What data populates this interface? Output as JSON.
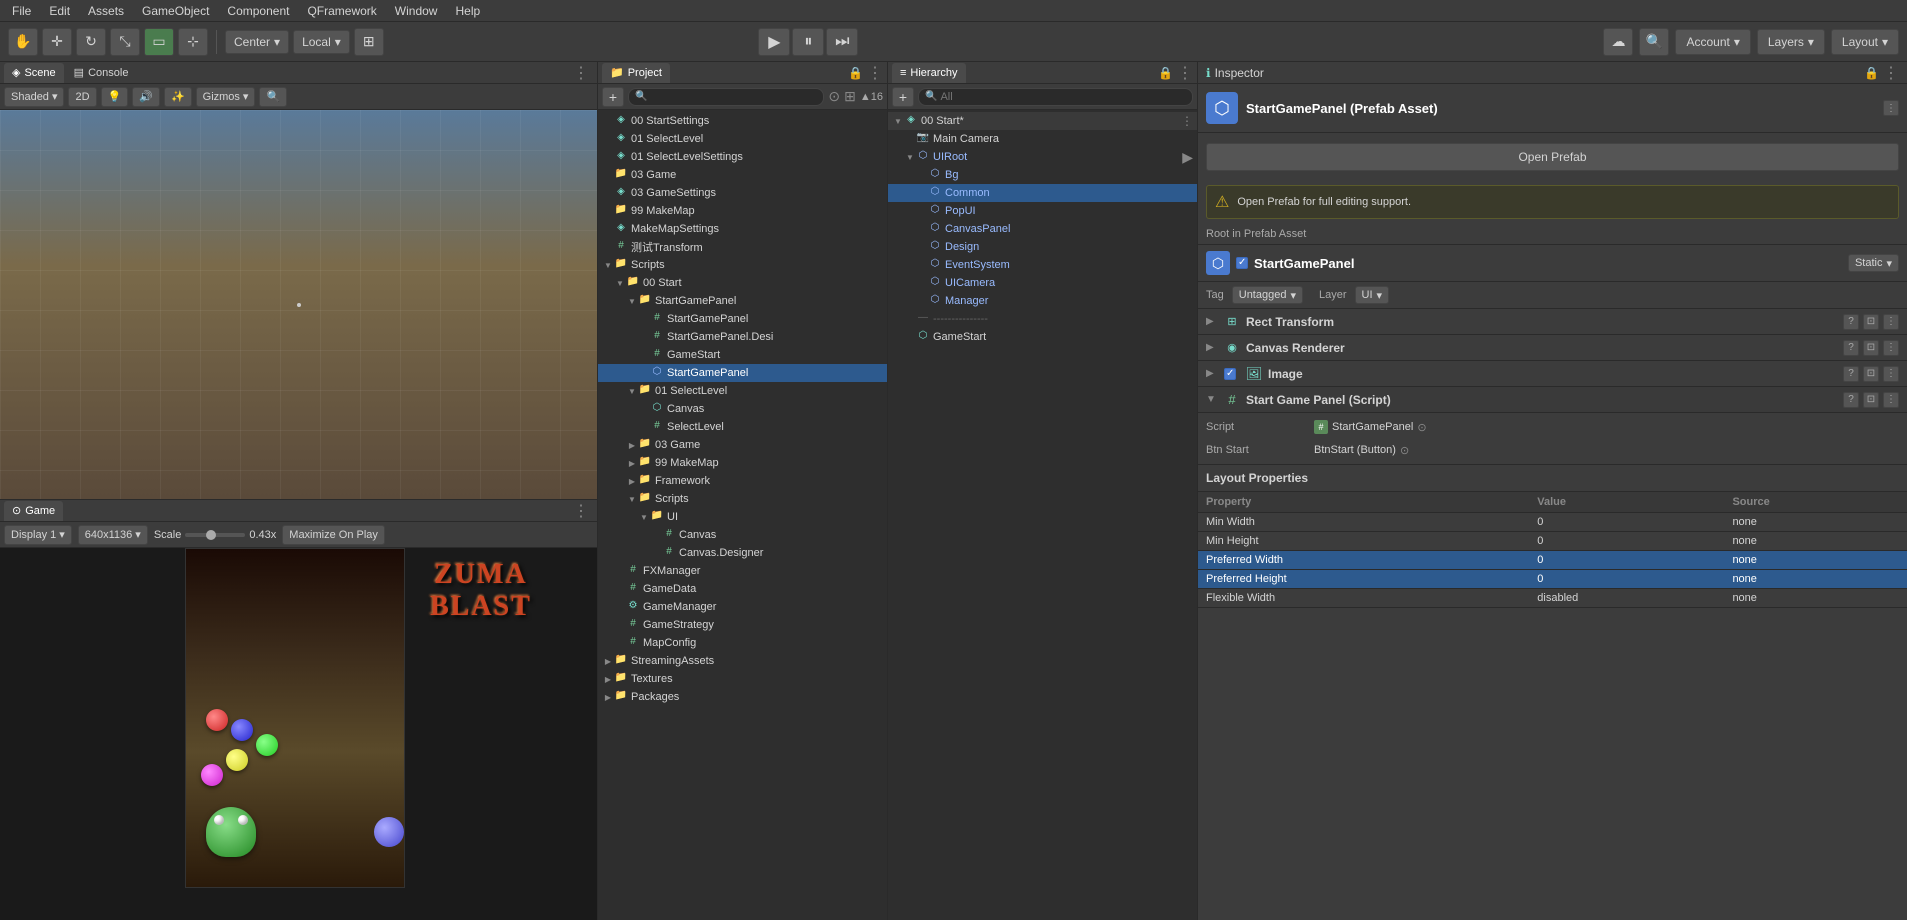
{
  "menubar": {
    "items": [
      "File",
      "Edit",
      "Assets",
      "GameObject",
      "Component",
      "QFramework",
      "Window",
      "Help"
    ]
  },
  "toolbar": {
    "tools": [
      "hand",
      "move",
      "rotate",
      "scale",
      "rect",
      "transform"
    ],
    "pivot_label": "Center",
    "space_label": "Local",
    "play_btn": "▶",
    "pause_btn": "⏸",
    "step_btn": "⏭",
    "account_label": "Account",
    "layers_label": "Layers",
    "layout_label": "Layout"
  },
  "scene_panel": {
    "tab_scene": "Scene",
    "tab_console": "Console",
    "shaded_label": "Shaded",
    "is_2d": "2D",
    "gizmos_label": "Gizmos"
  },
  "game_panel": {
    "tab_game": "Game",
    "display_label": "Display 1",
    "resolution_label": "640x1136",
    "scale_label": "Scale",
    "scale_value": "0.43x",
    "maximize_label": "Maximize On Play"
  },
  "project_panel": {
    "tab_label": "Project",
    "items": [
      {
        "name": "00 StartSettings",
        "type": "scene",
        "depth": 0
      },
      {
        "name": "01 SelectLevel",
        "type": "scene",
        "depth": 0
      },
      {
        "name": "01 SelectLevelSettings",
        "type": "scene",
        "depth": 0
      },
      {
        "name": "03 Game",
        "type": "folder",
        "depth": 0
      },
      {
        "name": "03 GameSettings",
        "type": "scene",
        "depth": 0
      },
      {
        "name": "99 MakeMap",
        "type": "folder",
        "depth": 0
      },
      {
        "name": "MakeMapSettings",
        "type": "scene",
        "depth": 0
      },
      {
        "name": "测试Transform",
        "type": "script",
        "depth": 0
      },
      {
        "name": "Scripts",
        "type": "folder",
        "depth": 0
      },
      {
        "name": "00 Start",
        "type": "folder",
        "depth": 1
      },
      {
        "name": "StartGamePanel",
        "type": "folder",
        "depth": 2
      },
      {
        "name": "StartGamePanel",
        "type": "script",
        "depth": 3
      },
      {
        "name": "StartGamePanel.Desi",
        "type": "script",
        "depth": 3
      },
      {
        "name": "GameStart",
        "type": "script",
        "depth": 3
      },
      {
        "name": "StartGamePanel",
        "type": "prefab",
        "depth": 3,
        "selected": true
      },
      {
        "name": "01 SelectLevel",
        "type": "folder",
        "depth": 2
      },
      {
        "name": "Canvas",
        "type": "gameobj",
        "depth": 3
      },
      {
        "name": "SelectLevel",
        "type": "script",
        "depth": 3
      },
      {
        "name": "03 Game",
        "type": "folder",
        "depth": 2
      },
      {
        "name": "99 MakeMap",
        "type": "folder",
        "depth": 2
      },
      {
        "name": "Framework",
        "type": "folder",
        "depth": 2
      },
      {
        "name": "Scripts",
        "type": "folder",
        "depth": 2
      },
      {
        "name": "UI",
        "type": "folder",
        "depth": 3
      },
      {
        "name": "Canvas",
        "type": "script",
        "depth": 4
      },
      {
        "name": "Canvas.Designer",
        "type": "script",
        "depth": 4
      },
      {
        "name": "FXManager",
        "type": "script",
        "depth": 1
      },
      {
        "name": "GameData",
        "type": "script",
        "depth": 1
      },
      {
        "name": "GameManager",
        "type": "gameobj",
        "depth": 1
      },
      {
        "name": "GameStrategy",
        "type": "script",
        "depth": 1
      },
      {
        "name": "MapConfig",
        "type": "script",
        "depth": 1
      },
      {
        "name": "StreamingAssets",
        "type": "folder",
        "depth": 0
      },
      {
        "name": "Textures",
        "type": "folder",
        "depth": 0
      },
      {
        "name": "Packages",
        "type": "folder",
        "depth": 0
      }
    ]
  },
  "hierarchy_panel": {
    "tab_label": "Hierarchy",
    "items": [
      {
        "name": "00 Start*",
        "type": "scene",
        "depth": 0,
        "has_arrow": true
      },
      {
        "name": "Main Camera",
        "type": "gameobj",
        "depth": 1
      },
      {
        "name": "UIRoot",
        "type": "prefab",
        "depth": 1,
        "has_arrow": true,
        "expanded": true
      },
      {
        "name": "Bg",
        "type": "prefab",
        "depth": 2
      },
      {
        "name": "Common",
        "type": "prefab",
        "depth": 2
      },
      {
        "name": "PopUI",
        "type": "prefab",
        "depth": 2
      },
      {
        "name": "CanvasPanel",
        "type": "prefab",
        "depth": 2
      },
      {
        "name": "Design",
        "type": "prefab",
        "depth": 2
      },
      {
        "name": "EventSystem",
        "type": "prefab",
        "depth": 2
      },
      {
        "name": "UICamera",
        "type": "prefab",
        "depth": 2
      },
      {
        "name": "Manager",
        "type": "prefab",
        "depth": 2
      },
      {
        "name": "---------------",
        "type": "separator",
        "depth": 1
      },
      {
        "name": "GameStart",
        "type": "gameobj",
        "depth": 1
      }
    ]
  },
  "inspector_panel": {
    "tab_label": "Inspector",
    "title": "StartGamePanel (Prefab Asset)",
    "open_prefab_btn": "Open Prefab",
    "warning_text": "Open Prefab for full editing support.",
    "root_in_prefab": "Root in Prefab Asset",
    "component_name": "StartGamePanel",
    "static_label": "Static",
    "tag_label": "Tag",
    "tag_value": "Untagged",
    "layer_label": "Layer",
    "layer_value": "UI",
    "components": [
      {
        "name": "Rect Transform",
        "icon": "⊞",
        "icon_color": "#7dc"
      },
      {
        "name": "Canvas Renderer",
        "icon": "◉",
        "icon_color": "#7dc"
      },
      {
        "name": "Image",
        "icon": "🖼",
        "icon_color": "#7dc",
        "checked": true
      },
      {
        "name": "Start Game Panel (Script)",
        "icon": "#",
        "icon_color": "#7c9"
      }
    ],
    "script_field": {
      "label": "Script",
      "value": "StartGamePanel"
    },
    "btn_start_field": {
      "label": "Btn Start",
      "value": "BtnStart (Button)"
    },
    "layout_props": {
      "header": "Layout Properties",
      "columns": [
        "Property",
        "Value",
        "Source"
      ],
      "rows": [
        {
          "property": "Min Width",
          "value": "0",
          "source": "none"
        },
        {
          "property": "Min Height",
          "value": "0",
          "source": "none"
        },
        {
          "property": "Preferred Width",
          "value": "0",
          "source": "none",
          "highlighted": true
        },
        {
          "property": "Preferred Height",
          "value": "0",
          "source": "none",
          "highlighted": true
        },
        {
          "property": "Flexible Width",
          "value": "disabled",
          "source": "none"
        }
      ]
    }
  }
}
